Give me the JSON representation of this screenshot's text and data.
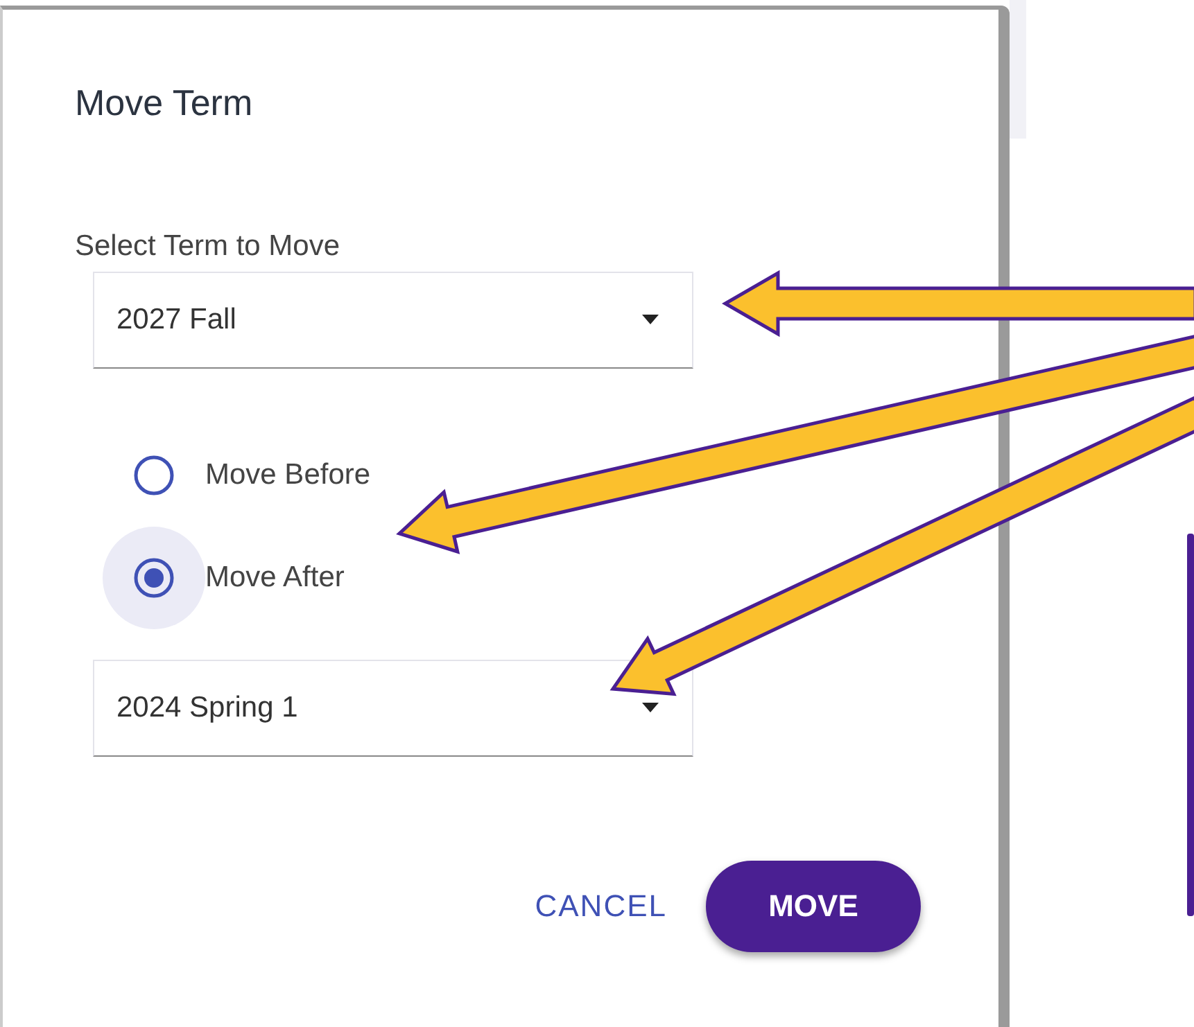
{
  "dialog": {
    "title": "Move Term",
    "term_select": {
      "label": "Select Term to Move",
      "value": "2027 Fall"
    },
    "position_options": [
      {
        "label": "Move Before",
        "selected": false
      },
      {
        "label": "Move After",
        "selected": true
      }
    ],
    "target_select": {
      "value": "2024 Spring 1"
    },
    "buttons": [
      {
        "label": "CANCEL",
        "kind": "text"
      },
      {
        "label": "MOVE",
        "kind": "primary"
      }
    ]
  }
}
